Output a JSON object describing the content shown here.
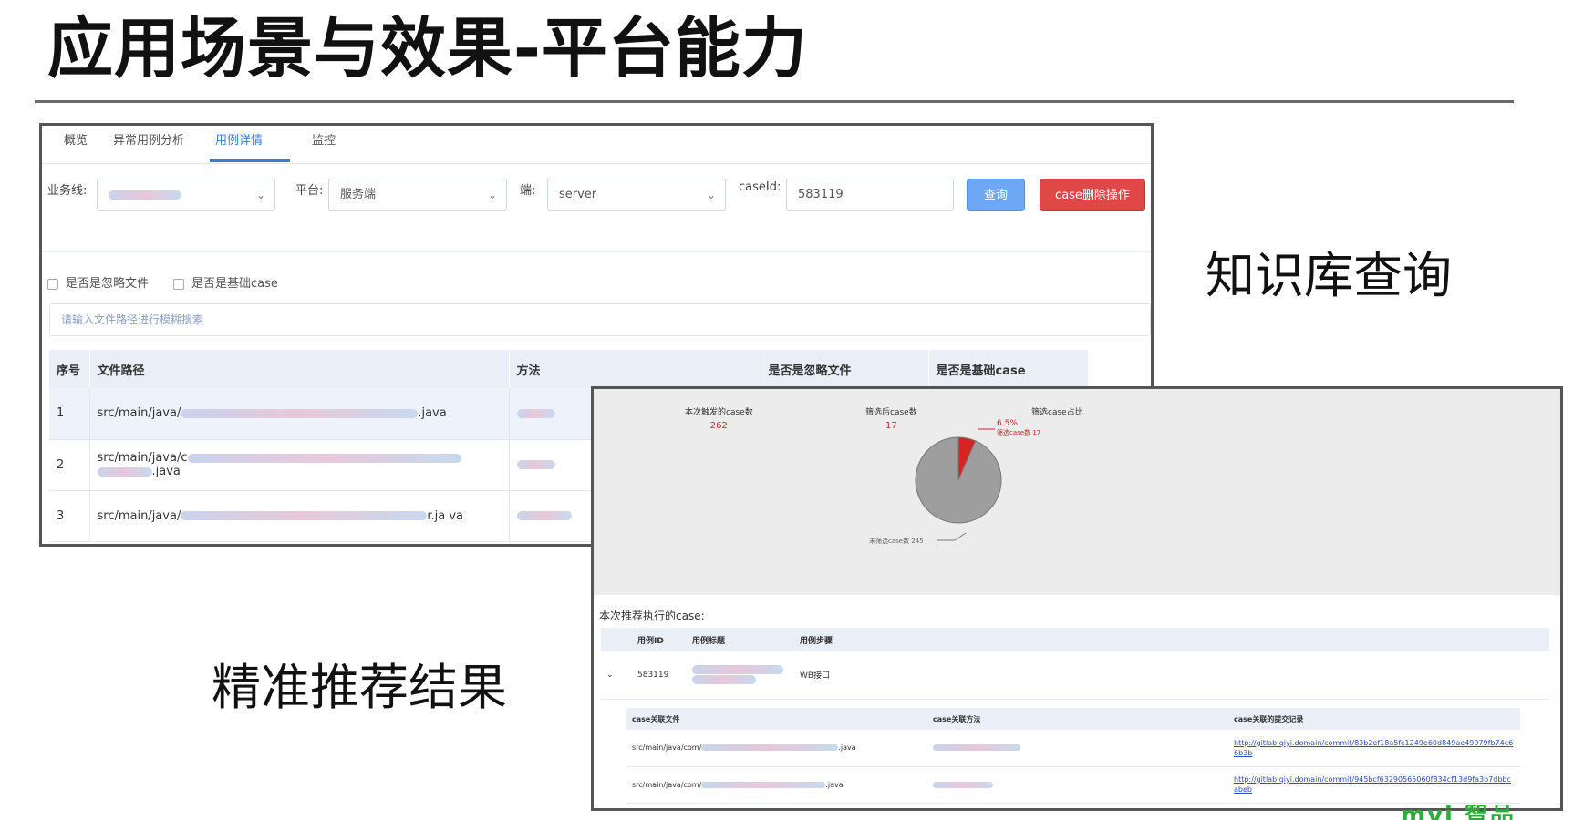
{
  "slide": {
    "title": "应用场景与效果-平台能力",
    "caption_knowledge": "知识库查询",
    "caption_recommend": "精准推荐结果",
    "logo_text": "mvi 智品"
  },
  "detail_panel": {
    "tabs": [
      {
        "label": "概览",
        "active": false
      },
      {
        "label": "异常用例分析",
        "active": false
      },
      {
        "label": "用例详情",
        "active": true
      },
      {
        "label": "监控",
        "active": false
      }
    ],
    "filters": {
      "business_line_label": "业务线:",
      "platform_label": "平台:",
      "platform_value": "服务端",
      "end_label": "端:",
      "end_value": "server",
      "caseid_label": "caseId:",
      "caseid_value": "583119",
      "query_button": "查询",
      "delete_button": "case删除操作"
    },
    "checkbox_ignore_files": "是否是忽略文件",
    "checkbox_base_case": "是否是基础case",
    "search_placeholder": "请输入文件路径进行模糊搜索",
    "table_headers": [
      "序号",
      "文件路径",
      "方法",
      "是否是忽略文件",
      "是否是基础case"
    ],
    "rows": [
      {
        "index": "1",
        "path_prefix": "src/main/java/",
        "path_suffix": ".java"
      },
      {
        "index": "2",
        "path_prefix": "src/main/java/c",
        "path_suffix": ".java"
      },
      {
        "index": "3",
        "path_prefix": "src/main/java/",
        "path_suffix": "r.ja va"
      }
    ]
  },
  "recommend_panel": {
    "stats": [
      {
        "label": "本次触发的case数",
        "value": "262"
      },
      {
        "label": "筛选后case数",
        "value": "17"
      },
      {
        "label": "筛选case占比",
        "value": ""
      }
    ],
    "pie_labels": {
      "selected_percent": "6.5%",
      "selected_label": "筛选case数 17",
      "other_label": "未筛选case数 245"
    },
    "rec_label": "本次推荐执行的case:",
    "table_headers": [
      "用例ID",
      "用例标题",
      "用例步骤"
    ],
    "case_row": {
      "expand": "⌄",
      "id": "583119",
      "step": "WB接口"
    },
    "sub_headers": [
      "case关联文件",
      "case关联方法",
      "case关联的提交记录"
    ],
    "sub_rows": [
      {
        "file_prefix": "src/main/java/com/",
        "file_suffix": ".java",
        "commit": "http://gitlab.qiyi.domain/commit/83b2ef18a5fc1249e60d849ae49979fb74c66b3b"
      },
      {
        "file_prefix": "src/main/java/com/",
        "file_suffix": ".java",
        "commit": "http://gitlab.qiyi.domain/commit/945bcf63290565060f834cf13d9fa3b7dbbcabeb"
      }
    ]
  },
  "chart_data": {
    "type": "pie",
    "categories": [
      "筛选case数",
      "未筛选case数"
    ],
    "values": [
      17,
      245
    ],
    "colors": [
      "#d62424",
      "#9e9e9e"
    ],
    "title": "",
    "percent_labels": [
      "6.5%"
    ]
  }
}
